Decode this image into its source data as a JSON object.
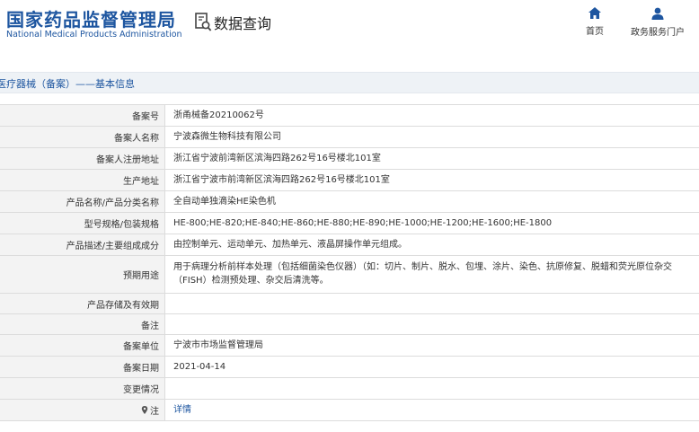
{
  "header": {
    "logo_cn": "国家药品监督管理局",
    "logo_en": "National Medical Products Administration",
    "query_title": "数据查询",
    "nav": {
      "home": "首页",
      "portal": "政务服务门户"
    },
    "accent_color": "#1e56a0"
  },
  "breadcrumb": "医疗器械（备案）——基本信息",
  "rows": [
    {
      "label": "备案号",
      "value": "浙甬械备20210062号"
    },
    {
      "label": "备案人名称",
      "value": "宁波森微生物科技有限公司"
    },
    {
      "label": "备案人注册地址",
      "value": "浙江省宁波前湾新区滨海四路262号16号楼北101室"
    },
    {
      "label": "生产地址",
      "value": "浙江省宁波市前湾新区滨海四路262号16号楼北101室"
    },
    {
      "label": "产品名称/产品分类名称",
      "value": "全自动单独滴染HE染色机"
    },
    {
      "label": "型号规格/包装规格",
      "value": "HE-800;HE-820;HE-840;HE-860;HE-880;HE-890;HE-1000;HE-1200;HE-1600;HE-1800"
    },
    {
      "label": "产品描述/主要组成成分",
      "value": "由控制单元、运动单元、加热单元、液晶屏操作单元组成。"
    },
    {
      "label": "预期用途",
      "value": "用于病理分析前样本处理（包括细菌染色仪器）（如：切片、制片、脱水、包埋、涂片、染色、抗原修复、脱蜡和荧光原位杂交（FISH）检测预处理、杂交后清洗等。"
    },
    {
      "label": "产品存储及有效期",
      "value": ""
    },
    {
      "label": "备注",
      "value": ""
    },
    {
      "label": "备案单位",
      "value": "宁波市市场监督管理局"
    },
    {
      "label": "备案日期",
      "value": "2021-04-14"
    },
    {
      "label": "变更情况",
      "value": ""
    },
    {
      "label": "注",
      "value": "详情"
    }
  ]
}
